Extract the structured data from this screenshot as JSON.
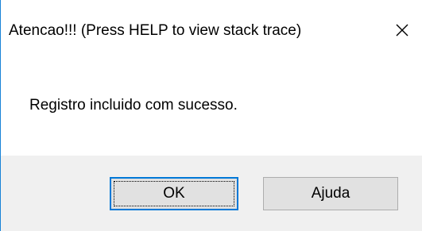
{
  "dialog": {
    "title": "Atencao!!! (Press HELP to view stack trace)",
    "message": "Registro incluido com sucesso.",
    "close_icon": "close-icon"
  },
  "buttons": {
    "ok_label": "OK",
    "help_label": "Ajuda"
  },
  "colors": {
    "accent": "#0078d7",
    "window_border": "#1883d7",
    "footer_background": "#f0f0f0",
    "button_background": "#e1e1e1"
  }
}
